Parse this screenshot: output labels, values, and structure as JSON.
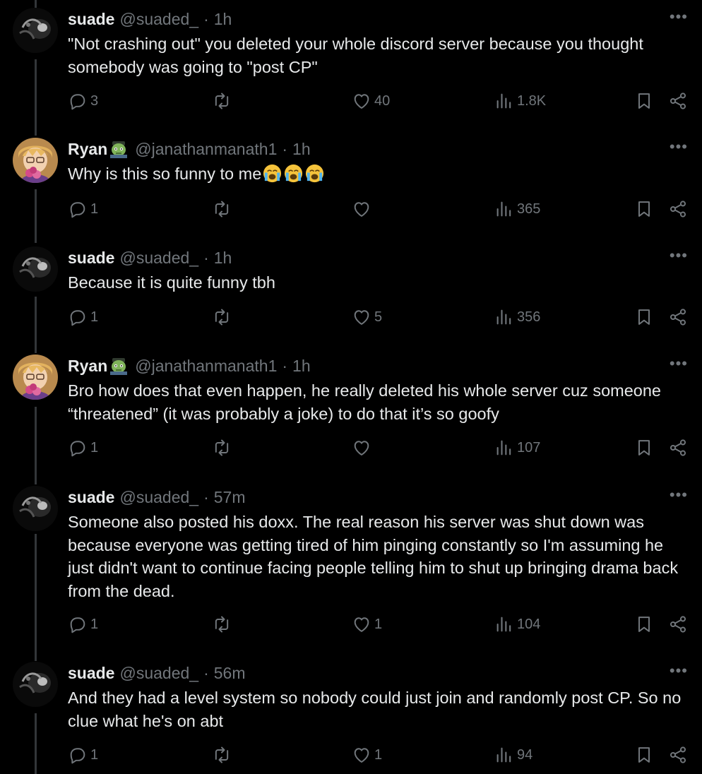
{
  "posts": [
    {
      "name": "suade",
      "handle": "@suaded_",
      "time": "1h",
      "has_emoji": false,
      "text": "\"Not crashing out\" you deleted your whole discord server because you thought somebody was going to \"post CP\"",
      "replies": "3",
      "reposts": "",
      "likes": "40",
      "views": "1.8K"
    },
    {
      "name": "Ryan",
      "handle": "@janathanmanath1",
      "time": "1h",
      "has_emoji": true,
      "text": "Why is this so funny to me",
      "trailing_emoji": "loudly-crying-face x3",
      "replies": "1",
      "reposts": "",
      "likes": "",
      "views": "365"
    },
    {
      "name": "suade",
      "handle": "@suaded_",
      "time": "1h",
      "has_emoji": false,
      "text": "Because it is quite funny tbh",
      "replies": "1",
      "reposts": "",
      "likes": "5",
      "views": "356"
    },
    {
      "name": "Ryan",
      "handle": "@janathanmanath1",
      "time": "1h",
      "has_emoji": true,
      "text": "Bro how does that even happen, he really deleted his whole server cuz someone “threatened” (it was probably a joke) to do that it’s so goofy",
      "replies": "1",
      "reposts": "",
      "likes": "",
      "views": "107"
    },
    {
      "name": "suade",
      "handle": "@suaded_",
      "time": "57m",
      "has_emoji": false,
      "text": "Someone also posted his doxx. The real reason his server was shut down was because everyone was getting tired of him pinging constantly so I'm assuming he just didn't want to continue facing people telling him to shut up bringing drama back from the dead.",
      "replies": "1",
      "reposts": "",
      "likes": "1",
      "views": "104"
    },
    {
      "name": "suade",
      "handle": "@suaded_",
      "time": "56m",
      "has_emoji": false,
      "text": "And they had a level system so nobody could just join and randomly post CP. So no clue what he's on abt",
      "replies": "1",
      "reposts": "",
      "likes": "1",
      "views": "94"
    }
  ],
  "ui": {
    "more_glyph": "•••",
    "separator": "·"
  },
  "icons": [
    "reply-icon",
    "repost-icon",
    "like-icon",
    "views-icon",
    "bookmark-icon",
    "share-icon",
    "more-icon",
    "zombie-emoji-icon",
    "loudly-crying-face-icon"
  ],
  "colors": {
    "background": "#000000",
    "text": "#e7e9ea",
    "muted": "#71767b",
    "thread_line": "#333639"
  }
}
